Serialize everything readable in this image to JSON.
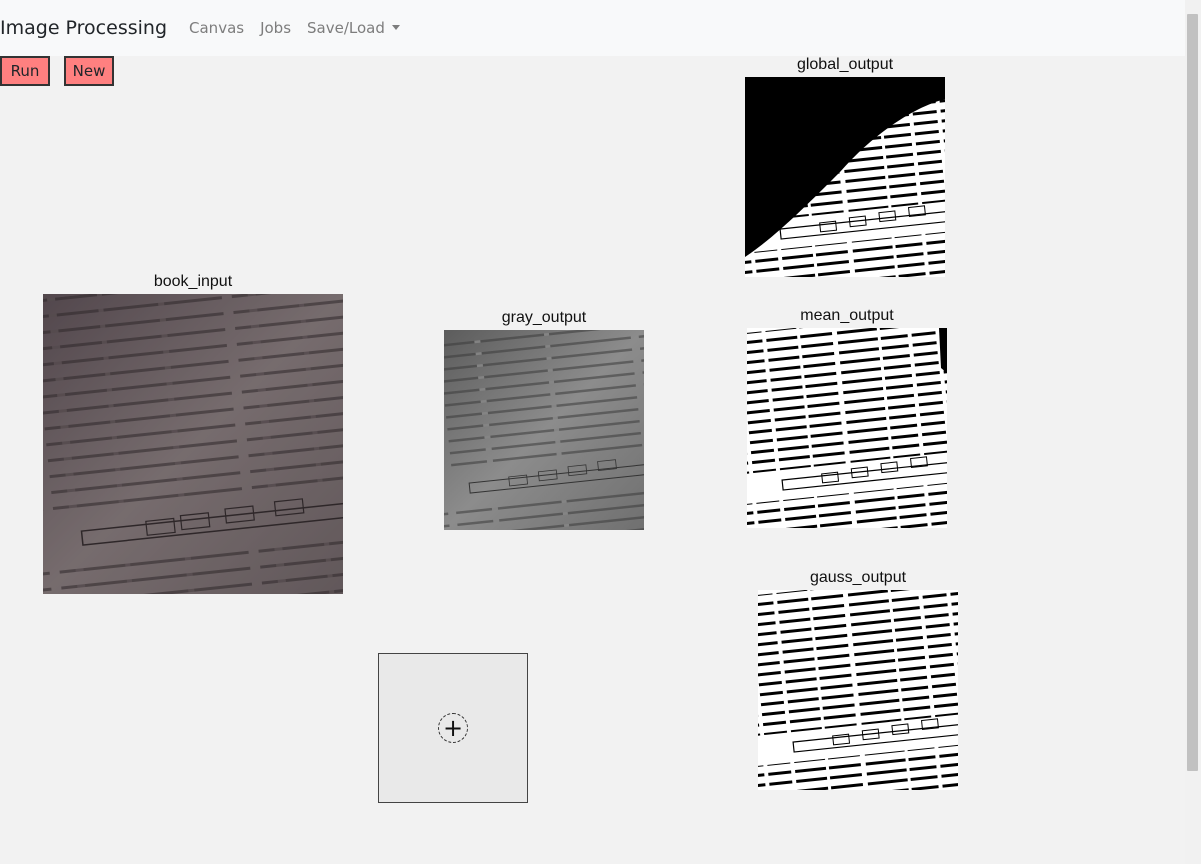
{
  "navbar": {
    "brand": "Image Processing",
    "links": [
      "Canvas",
      "Jobs"
    ],
    "dropdown_label": "Save/Load"
  },
  "toolbar": {
    "run_label": "Run",
    "new_label": "New",
    "button_color": "#ff8080"
  },
  "nodes": {
    "book_input": "book_input",
    "gray_output": "gray_output",
    "global_output": "global_output",
    "mean_output": "mean_output",
    "gauss_output": "gauss_output"
  },
  "add_node": {
    "icon": "plus-icon",
    "glyph": "+"
  }
}
